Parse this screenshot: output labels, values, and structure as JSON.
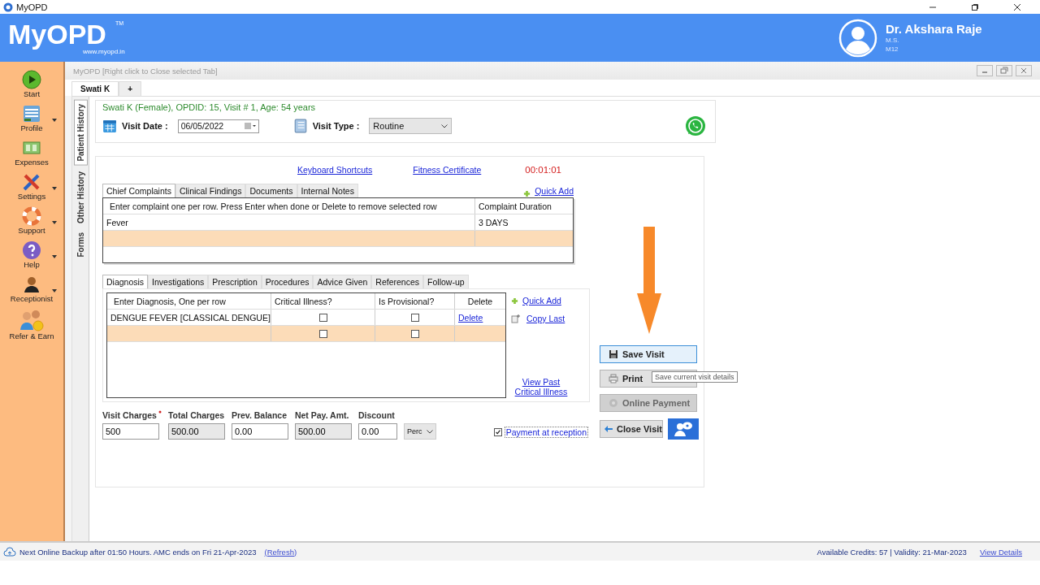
{
  "window": {
    "title": "MyOPD"
  },
  "header": {
    "logo": "MyOPD",
    "logo_mark": "TM",
    "website": "www.myopd.in",
    "doctor": {
      "name": "Dr. Akshara Raje",
      "degree": "M.S.",
      "code": "M12"
    }
  },
  "sidebar": {
    "items": [
      {
        "label": "Start",
        "kind": "start",
        "has_menu": false
      },
      {
        "label": "Profile",
        "kind": "profile",
        "has_menu": true
      },
      {
        "label": "Expenses",
        "kind": "expenses",
        "has_menu": false
      },
      {
        "label": "Settings",
        "kind": "settings",
        "has_menu": true
      },
      {
        "label": "Support",
        "kind": "support",
        "has_menu": true
      },
      {
        "label": "Help",
        "kind": "help",
        "has_menu": true
      },
      {
        "label": "Receptionist",
        "kind": "receptionist",
        "has_menu": true
      },
      {
        "label": "Refer & Earn",
        "kind": "refer",
        "has_menu": false
      }
    ]
  },
  "mdi": {
    "caption": "MyOPD [Right click to Close selected Tab]",
    "tabs": [
      {
        "label": "Swati K",
        "selected": true
      },
      {
        "label": "+",
        "selected": false
      }
    ]
  },
  "side_tabs": [
    {
      "label": "Patient History",
      "selected": true
    },
    {
      "label": "Other History",
      "selected": false
    },
    {
      "label": "Forms",
      "selected": false
    }
  ],
  "patient": {
    "summary": "Swati K (Female), OPDID: 15, Visit # 1, Age: 54 years",
    "visit_date_label": "Visit Date :",
    "visit_date": "06/05/2022",
    "visit_type_label": "Visit Type :",
    "visit_type": "Routine"
  },
  "links": {
    "keyboard": "Keyboard Shortcuts",
    "fitness": "Fitness Certificate",
    "timer": "00:01:01"
  },
  "complaints": {
    "tabs": [
      {
        "label": "Chief Complaints",
        "selected": true
      },
      {
        "label": "Clinical Findings",
        "selected": false
      },
      {
        "label": "Documents",
        "selected": false
      },
      {
        "label": "Internal Notes",
        "selected": false
      }
    ],
    "quick_add": "Quick Add",
    "columns": [
      "Enter complaint one per row. Press Enter when done or Delete to remove selected row",
      "Complaint Duration"
    ],
    "rows": [
      [
        "Fever",
        "3 DAYS"
      ]
    ]
  },
  "diagnosis": {
    "tabs": [
      {
        "label": "Diagnosis",
        "selected": true
      },
      {
        "label": "Investigations",
        "selected": false
      },
      {
        "label": "Prescription",
        "selected": false
      },
      {
        "label": "Procedures",
        "selected": false
      },
      {
        "label": "Advice Given",
        "selected": false
      },
      {
        "label": "References",
        "selected": false
      },
      {
        "label": "Follow-up",
        "selected": false
      }
    ],
    "columns": [
      "Enter Diagnosis, One per row",
      "Critical Illness?",
      "Is Provisional?",
      "Delete"
    ],
    "rows": [
      {
        "name": "DENGUE FEVER [CLASSICAL DENGUE]",
        "critical": false,
        "provisional": false,
        "action": "Delete"
      }
    ],
    "new_row": {
      "critical": false,
      "provisional": false
    },
    "quick_add": "Quick Add",
    "copy_last": "Copy Last",
    "view_past": "View Past Critical Illness"
  },
  "charges": {
    "fields": [
      {
        "label": "Visit Charges",
        "value": "500",
        "required": true,
        "readonly": false
      },
      {
        "label": "Total Charges",
        "value": "500.00",
        "required": false,
        "readonly": true
      },
      {
        "label": "Prev. Balance",
        "value": "0.00",
        "required": false,
        "readonly": false
      },
      {
        "label": "Net Pay. Amt.",
        "value": "500.00",
        "required": false,
        "readonly": true
      },
      {
        "label": "Discount",
        "value": "0.00",
        "required": false,
        "readonly": false
      }
    ],
    "discount_unit": "Perc"
  },
  "payment_at_reception": {
    "label": "Payment at reception",
    "checked": true
  },
  "actions": [
    {
      "label": "Save Visit",
      "kind": "save",
      "disabled": false
    },
    {
      "label": "Print",
      "kind": "print",
      "disabled": false
    },
    {
      "label": "Online Payment",
      "kind": "online",
      "disabled": true
    },
    {
      "label": "Close Visit",
      "kind": "close",
      "disabled": false
    }
  ],
  "tooltip": "Save current visit details",
  "status_bar": {
    "backup": "Next Online Backup after 01:50 Hours.  AMC ends on Fri 21-Apr-2023",
    "refresh": "(Refresh)",
    "credits": "Available Credits: 57 | Validity: 21-Mar-2023",
    "details": "View Details"
  }
}
